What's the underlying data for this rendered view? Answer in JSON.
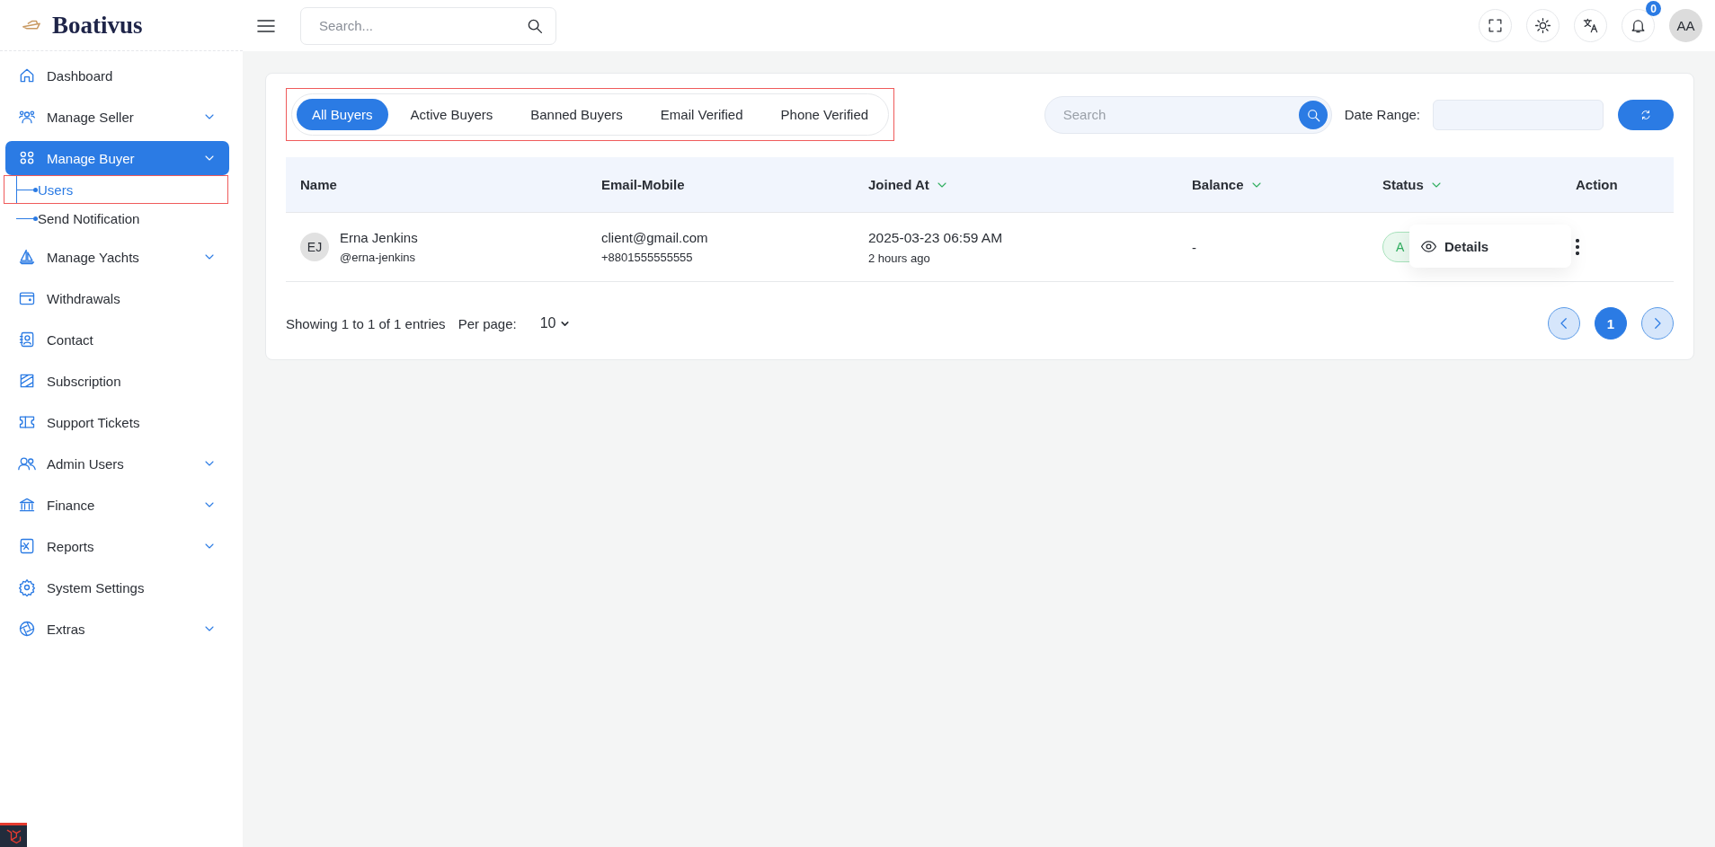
{
  "brand": {
    "name": "Boativus"
  },
  "topbar": {
    "search": {
      "placeholder": "Search..."
    },
    "notifications": {
      "count": "0"
    },
    "avatar": {
      "initials": "AA"
    }
  },
  "sidebar": {
    "items": [
      {
        "label": "Dashboard",
        "expandable": false,
        "selected": false
      },
      {
        "label": "Manage Seller",
        "expandable": true,
        "selected": false
      },
      {
        "label": "Manage Buyer",
        "expandable": true,
        "selected": true,
        "children": [
          {
            "label": "Users",
            "selected": true,
            "highlighted": true
          },
          {
            "label": "Send Notification",
            "selected": false,
            "highlighted": false
          }
        ]
      },
      {
        "label": "Manage Yachts",
        "expandable": true,
        "selected": false
      },
      {
        "label": "Withdrawals",
        "expandable": false,
        "selected": false
      },
      {
        "label": "Contact",
        "expandable": false,
        "selected": false
      },
      {
        "label": "Subscription",
        "expandable": false,
        "selected": false
      },
      {
        "label": "Support Tickets",
        "expandable": false,
        "selected": false
      },
      {
        "label": "Admin Users",
        "expandable": true,
        "selected": false
      },
      {
        "label": "Finance",
        "expandable": true,
        "selected": false
      },
      {
        "label": "Reports",
        "expandable": true,
        "selected": false
      },
      {
        "label": "System Settings",
        "expandable": false,
        "selected": false
      },
      {
        "label": "Extras",
        "expandable": true,
        "selected": false
      }
    ]
  },
  "tabs": {
    "highlighted": true,
    "items": [
      {
        "label": "All Buyers",
        "selected": true
      },
      {
        "label": "Active Buyers",
        "selected": false
      },
      {
        "label": "Banned Buyers",
        "selected": false
      },
      {
        "label": "Email Verified",
        "selected": false
      },
      {
        "label": "Phone Verified",
        "selected": false
      }
    ]
  },
  "filters": {
    "search": {
      "placeholder": "Search"
    },
    "date_range": {
      "label": "Date Range:"
    }
  },
  "table": {
    "columns": [
      {
        "label": "Name",
        "sortable": false
      },
      {
        "label": "Email-Mobile",
        "sortable": false
      },
      {
        "label": "Joined At",
        "sortable": true
      },
      {
        "label": "Balance",
        "sortable": true
      },
      {
        "label": "Status",
        "sortable": true
      },
      {
        "label": "Action",
        "sortable": false
      }
    ],
    "rows": [
      {
        "initials": "EJ",
        "name": "Erna Jenkins",
        "username": "@erna-jenkins",
        "email": "client@gmail.com",
        "mobile": "+8801555555555",
        "joined": "2025-03-23 06:59 AM",
        "joined_ago": "2 hours ago",
        "balance": "-",
        "status": "A",
        "menu_open": true
      }
    ]
  },
  "action_menu": {
    "items": [
      "Details"
    ]
  },
  "footer": {
    "summary": "Showing 1 to 1 of 1 entries",
    "per_page_label": "Per page:",
    "per_page": "10",
    "pages": [
      {
        "label": "1",
        "selected": true
      }
    ]
  }
}
